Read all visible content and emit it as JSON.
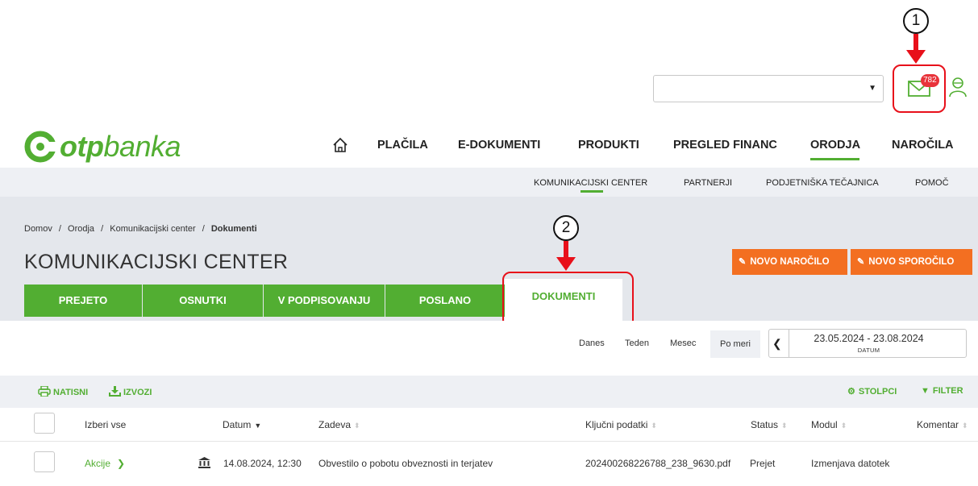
{
  "top": {
    "mail_badge": "782",
    "annotations": [
      "1",
      "2"
    ]
  },
  "brand": {
    "logo_prefix": "otp",
    "logo_suffix": "banka"
  },
  "main_nav": {
    "items": [
      "PLAČILA",
      "E-DOKUMENTI",
      "PRODUKTI",
      "PREGLED FINANC",
      "ORODJA",
      "NAROČILA"
    ],
    "active": "ORODJA"
  },
  "sub_nav": {
    "items": [
      "KOMUNIKACIJSKI CENTER",
      "PARTNERJI",
      "PODJETNIŠKA TEČAJNICA",
      "POMOČ"
    ],
    "active": "KOMUNIKACIJSKI CENTER"
  },
  "breadcrumb": {
    "items": [
      "Domov",
      "Orodja",
      "Komunikacijski center"
    ],
    "current": "Dokumenti",
    "separator": "/"
  },
  "page": {
    "title": "KOMUNIKACIJSKI CENTER"
  },
  "actions": {
    "new_order": "NOVO NAROČILO",
    "new_message": "NOVO SPOROČILO"
  },
  "tabs": {
    "items": [
      "PREJETO",
      "OSNUTKI",
      "V PODPISOVANJU",
      "POSLANO",
      "DOKUMENTI"
    ],
    "active": "DOKUMENTI"
  },
  "period": {
    "options": [
      "Danes",
      "Teden",
      "Mesec",
      "Po meri"
    ],
    "active": "Po meri",
    "date_range": "23.05.2024 - 23.08.2024",
    "date_label": "DATUM"
  },
  "toolbar": {
    "print": "NATISNI",
    "export": "IZVOZI",
    "columns": "STOLPCI",
    "filter": "FILTER"
  },
  "table": {
    "headers": {
      "select_all": "Izberi vse",
      "date": "Datum",
      "subject": "Zadeva",
      "key_data": "Ključni podatki",
      "status": "Status",
      "module": "Modul",
      "comment": "Komentar"
    },
    "rows": [
      {
        "actions": "Akcije",
        "date": "14.08.2024, 12:30",
        "subject": "Obvestilo o pobotu obveznosti in terjatev",
        "key_data": "202400268226788_238_9630.pdf",
        "status": "Prejet",
        "module": "Izmenjava datotek",
        "comment": ""
      }
    ]
  },
  "colors": {
    "brand_green": "#52ae32",
    "action_orange": "#f36f21",
    "annotation_red": "#e8101a",
    "badge_red": "#e8333a"
  }
}
